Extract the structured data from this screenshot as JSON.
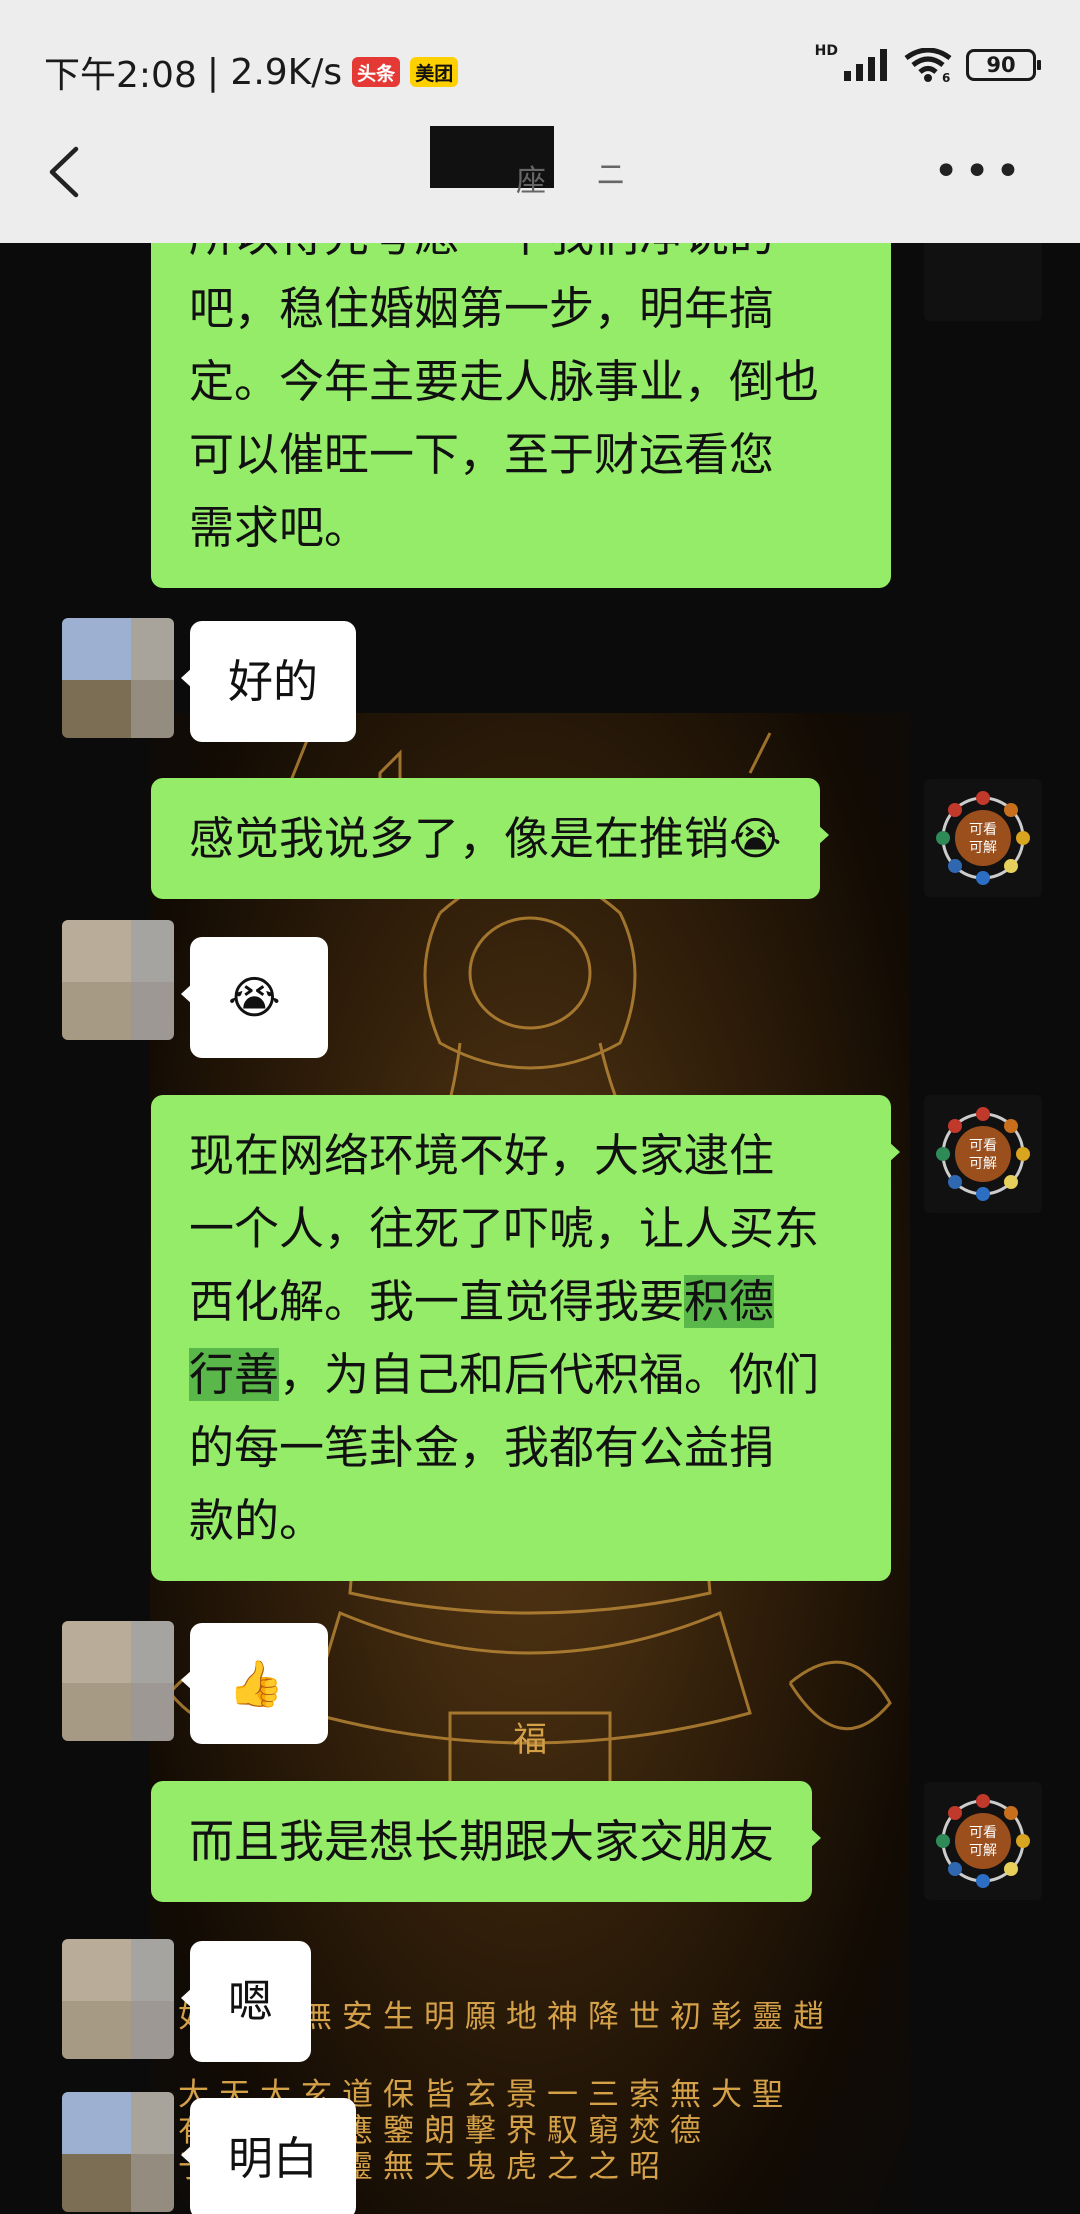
{
  "status_bar": {
    "time": "下午2:08",
    "speed": "| 2.9K/s",
    "badge_toutiao": "头条",
    "badge_meituan": "美团",
    "network": "HD",
    "wifi_sub": "6",
    "battery": "90"
  },
  "header": {
    "title_fragment": "座",
    "title_fragment2": "ニ"
  },
  "my_avatar": {
    "top_label": "可看",
    "bottom_label": "可解"
  },
  "messages": [
    {
      "sender": "me",
      "lines": [
        "所以得先考虑一下我们净说的",
        "吧，稳住婚姻第一步，明年搞",
        "定。今年主要走人脉事业，倒也",
        "可以催旺一下，至于财运看您",
        "需求吧。"
      ]
    },
    {
      "sender": "other",
      "text": "好的"
    },
    {
      "sender": "me",
      "text": "感觉我说多了，像是在推销",
      "emoji": "crying-laughing"
    },
    {
      "sender": "other",
      "emoji": "crying-laughing"
    },
    {
      "sender": "me",
      "lines": [
        "现在网络环境不好，大家逮住",
        "一个人，往死了吓唬，让人买东",
        "西化解。我一直觉得我要积德",
        "行善，为自己和后代积福。你们",
        "的每一笔卦金，我都有公益捐",
        "款的。"
      ],
      "highlight": [
        "积德",
        "行善"
      ]
    },
    {
      "sender": "other",
      "emoji": "thumbs-up"
    },
    {
      "sender": "me",
      "text": "而且我是想长期跟大家交朋友"
    },
    {
      "sender": "other",
      "text": "嗯"
    },
    {
      "sender": "other",
      "text": "明白"
    }
  ],
  "background_poster": {
    "row1": "如聖水無安生明願地神降世初彰靈趙",
    "row2": "大天大玄道保皆玄景一三索無大聖",
    "row3": "有風法家應鑒朗擊界馭窮焚德",
    "row4": "于以國救靈無天鬼虎之之昭",
    "side_text": "福"
  }
}
